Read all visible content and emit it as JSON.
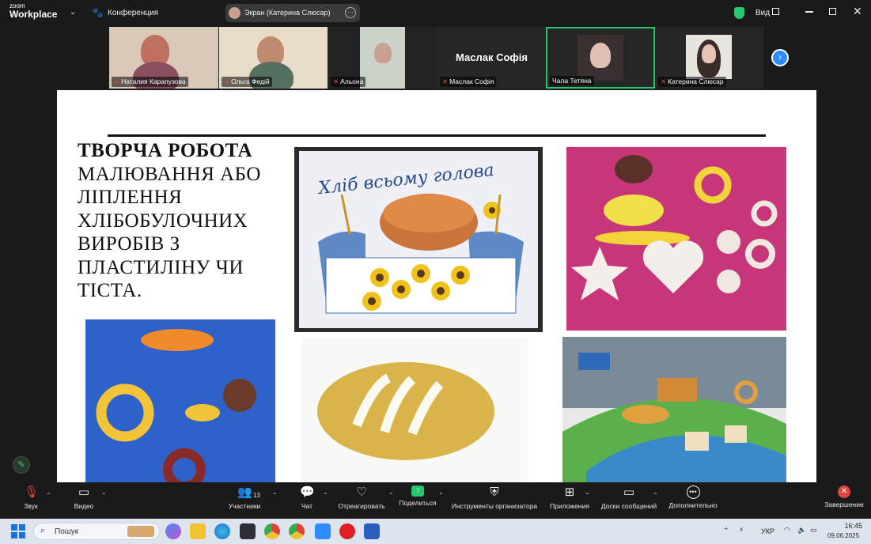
{
  "app": {
    "logo_line1": "zoom",
    "logo_line2": "Workplace",
    "meeting_label": "Конференция"
  },
  "screen_share": {
    "label": "Экран (Катерина Слюсар)"
  },
  "view": {
    "label": "Вид"
  },
  "participants": [
    {
      "name": "Наталия Карапузова"
    },
    {
      "name": "Ольга Федій"
    },
    {
      "name": "Альона"
    },
    {
      "name": "Маслак Софія",
      "big_name": "Маслак Софія"
    },
    {
      "name": "Чала Тетяна"
    },
    {
      "name": "Катерина Слюсар"
    }
  ],
  "slide": {
    "title_bold": "ТВОРЧА РОБОТА",
    "title_rest": "МАЛЮВАННЯ АБО ЛІПЛЕННЯ ХЛІБОБУЛОЧНИХ ВИРОБІВ З ПЛАСТИЛІНУ ЧИ ТІСТА.",
    "drawing_text": "Хліб всьому голова"
  },
  "toolbar": {
    "audio": "Звук",
    "video": "Видео",
    "participants": "Участники",
    "participants_count": "13",
    "chat": "Чат",
    "react": "Отреагировать",
    "share": "Поделиться",
    "host_tools": "Инструменты организатора",
    "apps": "Приложения",
    "whiteboards": "Доски сообщений",
    "more": "Дополнительно",
    "end": "Завершение"
  },
  "taskbar": {
    "search_placeholder": "Пошук",
    "lang": "УКР",
    "time": "16:45",
    "date": "09.06.2025"
  },
  "colors": {
    "accent": "#2d8cff",
    "active_border": "#28c76f",
    "end_red": "#e0443e"
  }
}
